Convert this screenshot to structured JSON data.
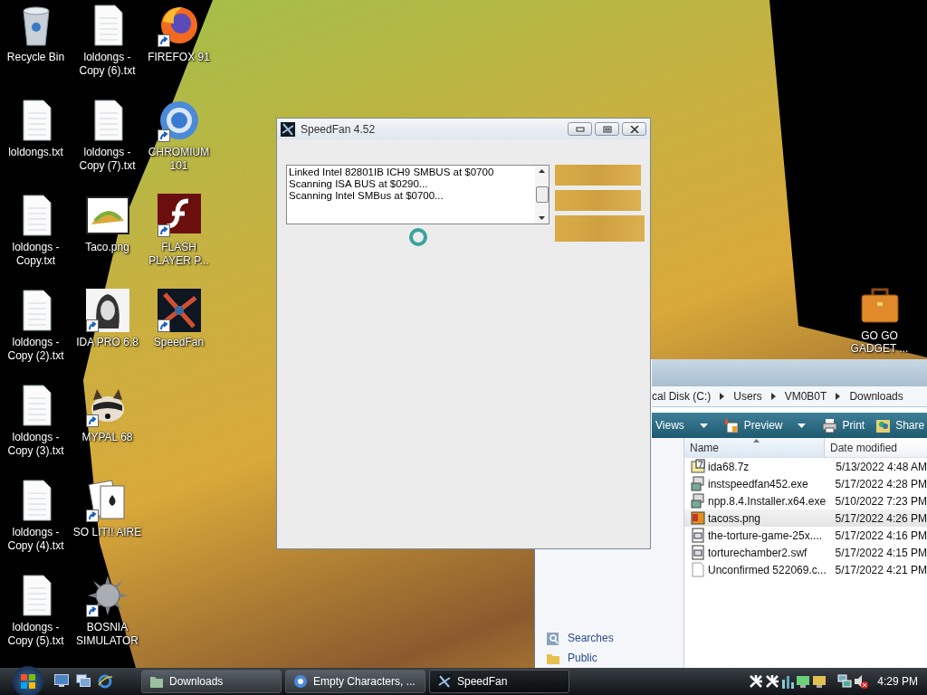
{
  "desktop_icons": [
    {
      "label": "Recycle Bin",
      "kind": "recycle",
      "shortcut": false
    },
    {
      "label": "loldongs.txt",
      "kind": "text",
      "shortcut": false
    },
    {
      "label": "loldongs - Copy.txt",
      "kind": "text",
      "shortcut": false
    },
    {
      "label": "loldongs - Copy (2).txt",
      "kind": "text",
      "shortcut": false
    },
    {
      "label": "loldongs - Copy (3).txt",
      "kind": "text",
      "shortcut": false
    },
    {
      "label": "loldongs - Copy (4).txt",
      "kind": "text",
      "shortcut": false
    },
    {
      "label": "loldongs - Copy (5).txt",
      "kind": "text",
      "shortcut": false
    },
    {
      "label": "loldongs - Copy (6).txt",
      "kind": "text",
      "shortcut": false
    },
    {
      "label": "loldongs - Copy (7).txt",
      "kind": "text",
      "shortcut": false
    },
    {
      "label": "Taco.png",
      "kind": "image",
      "shortcut": false
    },
    {
      "label": "IDA PRO 6.8",
      "kind": "portrait",
      "shortcut": true
    },
    {
      "label": "MYPAL 68",
      "kind": "raccoon",
      "shortcut": true
    },
    {
      "label": "SO LIT!! AIRE",
      "kind": "cards",
      "shortcut": true
    },
    {
      "label": "BOSNIA SIMULATOR",
      "kind": "mace",
      "shortcut": true
    },
    {
      "label": "FIREFOX 91",
      "kind": "firefox",
      "shortcut": true
    },
    {
      "label": "CHROMIUM 101",
      "kind": "chromium",
      "shortcut": true
    },
    {
      "label": "FLASH PLAYER P...",
      "kind": "flash",
      "shortcut": true
    },
    {
      "label": "SpeedFan",
      "kind": "fan",
      "shortcut": true
    }
  ],
  "gadget_icon": {
    "label": "GO GO GADGET ...",
    "kind": "briefcase",
    "shortcut": false
  },
  "speedfan": {
    "title": "SpeedFan 4.52",
    "log": [
      "Linked Intel 82801IB ICH9 SMBUS at $0700",
      "Scanning ISA BUS at $0290...",
      "Scanning Intel SMBus at $0700..."
    ]
  },
  "explorer": {
    "breadcrumb": [
      "cal Disk (C:)",
      "Users",
      "VM0B0T",
      "Downloads"
    ],
    "toolbar": [
      {
        "label": "Views",
        "kind": "views",
        "dropdown": true
      },
      {
        "label": "Preview",
        "kind": "preview",
        "dropdown": true
      },
      {
        "label": "Print",
        "kind": "print",
        "dropdown": false
      },
      {
        "label": "Share",
        "kind": "share",
        "dropdown": false
      }
    ],
    "nav": [
      {
        "label": "Searches",
        "kind": "searches"
      },
      {
        "label": "Public",
        "kind": "folder"
      }
    ],
    "columns": [
      "Name",
      "Date modified"
    ],
    "rows": [
      {
        "name": "ida68.7z",
        "date": "5/13/2022 4:48 AM",
        "kind": "archive",
        "selected": false
      },
      {
        "name": "instspeedfan452.exe",
        "date": "5/17/2022 4:28 PM",
        "kind": "installer",
        "selected": false
      },
      {
        "name": "npp.8.4.Installer.x64.exe",
        "date": "5/10/2022 7:23 PM",
        "kind": "installer",
        "selected": false
      },
      {
        "name": "tacoss.png",
        "date": "5/17/2022 4:26 PM",
        "kind": "image",
        "selected": true
      },
      {
        "name": "the-torture-game-25x....",
        "date": "5/17/2022 4:16 PM",
        "kind": "flash",
        "selected": false
      },
      {
        "name": "torturechamber2.swf",
        "date": "5/17/2022 4:15 PM",
        "kind": "flash",
        "selected": false
      },
      {
        "name": "Unconfirmed 522069.c...",
        "date": "5/17/2022 4:21 PM",
        "kind": "blank",
        "selected": false
      }
    ]
  },
  "taskbar": {
    "tasks": [
      {
        "label": "Downloads",
        "kind": "folder",
        "selected": false
      },
      {
        "label": "Empty Characters, ...",
        "kind": "browser",
        "selected": false
      },
      {
        "label": "SpeedFan",
        "kind": "fan",
        "selected": true
      }
    ],
    "clock": "4:29 PM"
  }
}
